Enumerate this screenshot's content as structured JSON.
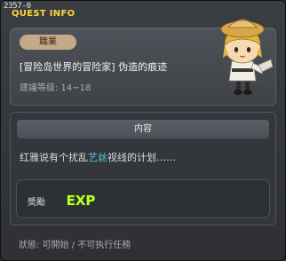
{
  "window": {
    "quest_id": "2357-0",
    "title": "QUEST INFO"
  },
  "quest": {
    "job_label": "職業",
    "name": "[冒险岛世界的冒险家] 伪造的痕迹",
    "level_range": "建議等级: 14~18"
  },
  "content": {
    "header": "内容",
    "description_pre": "红雅说有个扰乱",
    "description_highlight": "艺丝",
    "description_post": "视线的计划……"
  },
  "reward": {
    "label": "奬勵",
    "icon": "exp-icon",
    "icon_text": "EXP"
  },
  "status": {
    "text": "狀態: 可開始 / 不可执行任務"
  },
  "colors": {
    "title": "#ffd83a",
    "highlight": "#4fd2e6",
    "exp_fill": "#b6ff2a"
  }
}
